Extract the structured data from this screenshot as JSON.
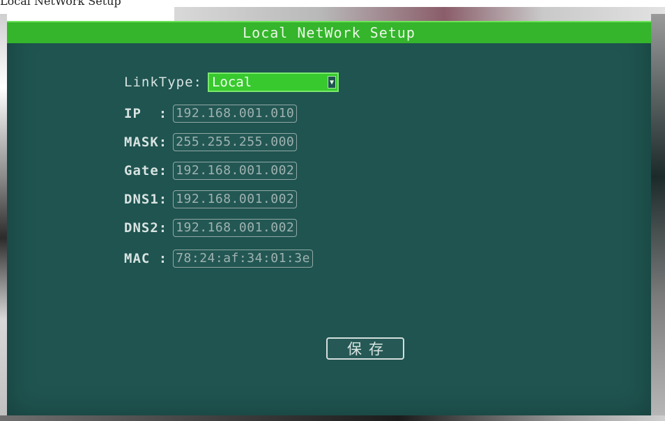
{
  "caption": "Local NetWork Setup",
  "window": {
    "title": "Local NetWork Setup"
  },
  "form": {
    "link_type": {
      "label": "LinkType:",
      "value": "Local",
      "arrow_icon": "dropdown-arrow-icon"
    },
    "ip": {
      "label": "IP  :",
      "value": "192.168.001.010"
    },
    "mask": {
      "label": "MASK:",
      "value": "255.255.255.000"
    },
    "gate": {
      "label": "Gate:",
      "value": "192.168.001.002"
    },
    "dns1": {
      "label": "DNS1:",
      "value": "192.168.001.002"
    },
    "dns2": {
      "label": "DNS2:",
      "value": "192.168.001.002"
    },
    "mac": {
      "label": "MAC :",
      "value": "78:24:af:34:01:3e"
    }
  },
  "save_button": {
    "label": "保存"
  },
  "colors": {
    "panel_bg": "#1f5450",
    "title_bar": "#34b52b",
    "select_bg": "#37c92e",
    "label_text": "#d8e3e1",
    "field_text": "#9fb3b1"
  }
}
